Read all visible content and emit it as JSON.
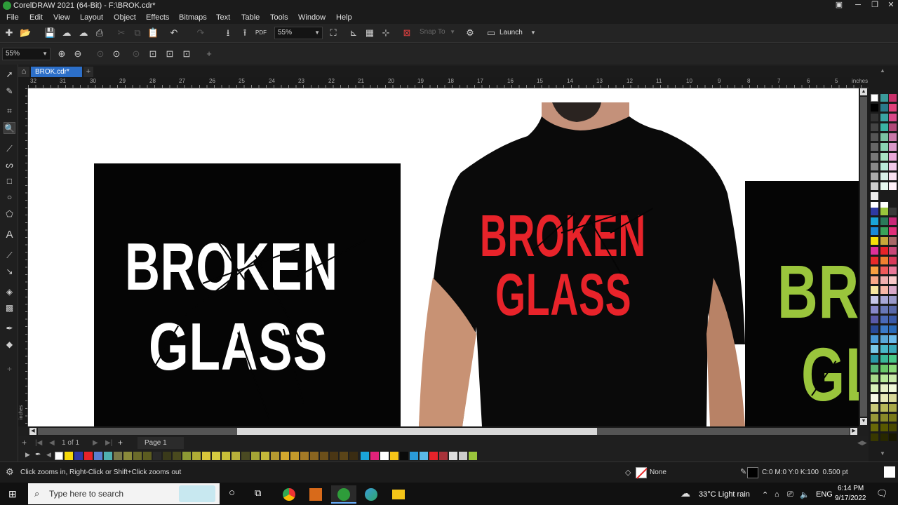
{
  "window": {
    "title": "CorelDRAW 2021 (64-Bit) - F:\\BROK.cdr*"
  },
  "menu": [
    "File",
    "Edit",
    "View",
    "Layout",
    "Object",
    "Effects",
    "Bitmaps",
    "Text",
    "Table",
    "Tools",
    "Window",
    "Help"
  ],
  "toolbar": {
    "zoom_value": "55%",
    "snap_label": "Snap To",
    "launch_label": "Launch"
  },
  "propertybar": {
    "zoom_value": "55%"
  },
  "document": {
    "tab_label": "BROK.cdr*"
  },
  "ruler": {
    "labels": [
      "32",
      "31",
      "30",
      "29",
      "28",
      "27",
      "26",
      "25",
      "24",
      "23",
      "22",
      "21",
      "20",
      "19",
      "18",
      "17",
      "16",
      "15",
      "14",
      "13",
      "12",
      "11",
      "10",
      "9",
      "8",
      "7",
      "6",
      "5"
    ],
    "unit": "inches",
    "vertical_unit": "inches"
  },
  "designs": {
    "white": {
      "line1": "BROKEN",
      "line2": "GLASS",
      "color": "#ffffff",
      "bg": "#050505"
    },
    "red": {
      "line1": "BROKEN",
      "line2": "GLASS",
      "color": "#e8232a"
    },
    "green": {
      "line1": "BR",
      "line2": "GL",
      "color": "#9ac53c",
      "bg": "#050505"
    }
  },
  "pages": {
    "counter": "1 of 1",
    "page_tab": "Page 1"
  },
  "status": {
    "hint": "Click zooms in, Right-Click or Shift+Click zooms out",
    "fill_label": "None",
    "outline_label": "C:0 M:0 Y:0 K:100  0.500 pt"
  },
  "taskbar": {
    "search_placeholder": "Type here to search",
    "weather": "33°C  Light rain",
    "language": "ENG",
    "time": "6:14 PM",
    "date": "9/17/2022"
  },
  "colors": {
    "accent": "#2c6fc9",
    "red_text": "#e8232a",
    "green_text": "#9ac53c"
  }
}
